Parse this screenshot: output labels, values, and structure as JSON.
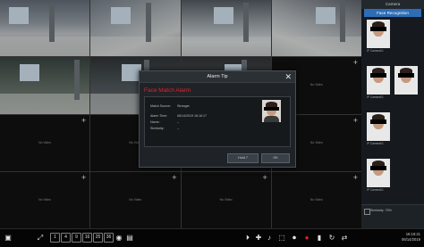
{
  "colors": {
    "accent": "#2d6db5",
    "alarm_red": "#e0232d",
    "background": "#0b0b0b"
  },
  "grid": {
    "cells": [
      {
        "type": "feed",
        "feed": "hall1"
      },
      {
        "type": "feed",
        "feed": "hall2"
      },
      {
        "type": "feed",
        "feed": "lobby"
      },
      {
        "type": "feed",
        "feed": "hall3"
      },
      {
        "type": "feed",
        "feed": "room1"
      },
      {
        "type": "feed",
        "feed": "room2"
      },
      {
        "type": "feed",
        "feed": "room2"
      },
      {
        "type": "empty",
        "label": "No Video"
      },
      {
        "type": "empty",
        "label": "No Video"
      },
      {
        "type": "empty",
        "label": "No Video"
      },
      {
        "type": "empty",
        "label": "No Video"
      },
      {
        "type": "empty",
        "label": "No Video"
      },
      {
        "type": "empty",
        "label": "No Video"
      },
      {
        "type": "empty",
        "label": "No Video"
      },
      {
        "type": "empty",
        "label": "No Video"
      },
      {
        "type": "empty",
        "label": "No Video"
      }
    ],
    "add_icon": "+"
  },
  "right_panel": {
    "title": "Camera",
    "tab": "Face Recognition",
    "matches": [
      {
        "caption": "IP Camera01"
      },
      {
        "caption": "IP Camera01"
      },
      {
        "caption": "IP Camera01"
      },
      {
        "caption": "IP Camera01"
      }
    ],
    "bottom_label": "Similarity: 75%"
  },
  "dialog": {
    "title": "Alarm Tip",
    "close": "✕",
    "heading": "Face Match Alarm",
    "rows": [
      {
        "label": "Match Source:",
        "value": "Stranger"
      },
      {
        "label": "Alarm Time:",
        "value": "06/14/2019 16:16:17"
      },
      {
        "label": "Name:",
        "value": "--"
      },
      {
        "label": "Similarity:",
        "value": "--"
      }
    ],
    "buttons": {
      "left": "Hold  7",
      "right": "OK"
    }
  },
  "taskbar": {
    "buttons": [
      "1",
      "4",
      "9",
      "16",
      "25",
      "36"
    ],
    "time": "16:16:21",
    "date": "06/14/2019"
  }
}
